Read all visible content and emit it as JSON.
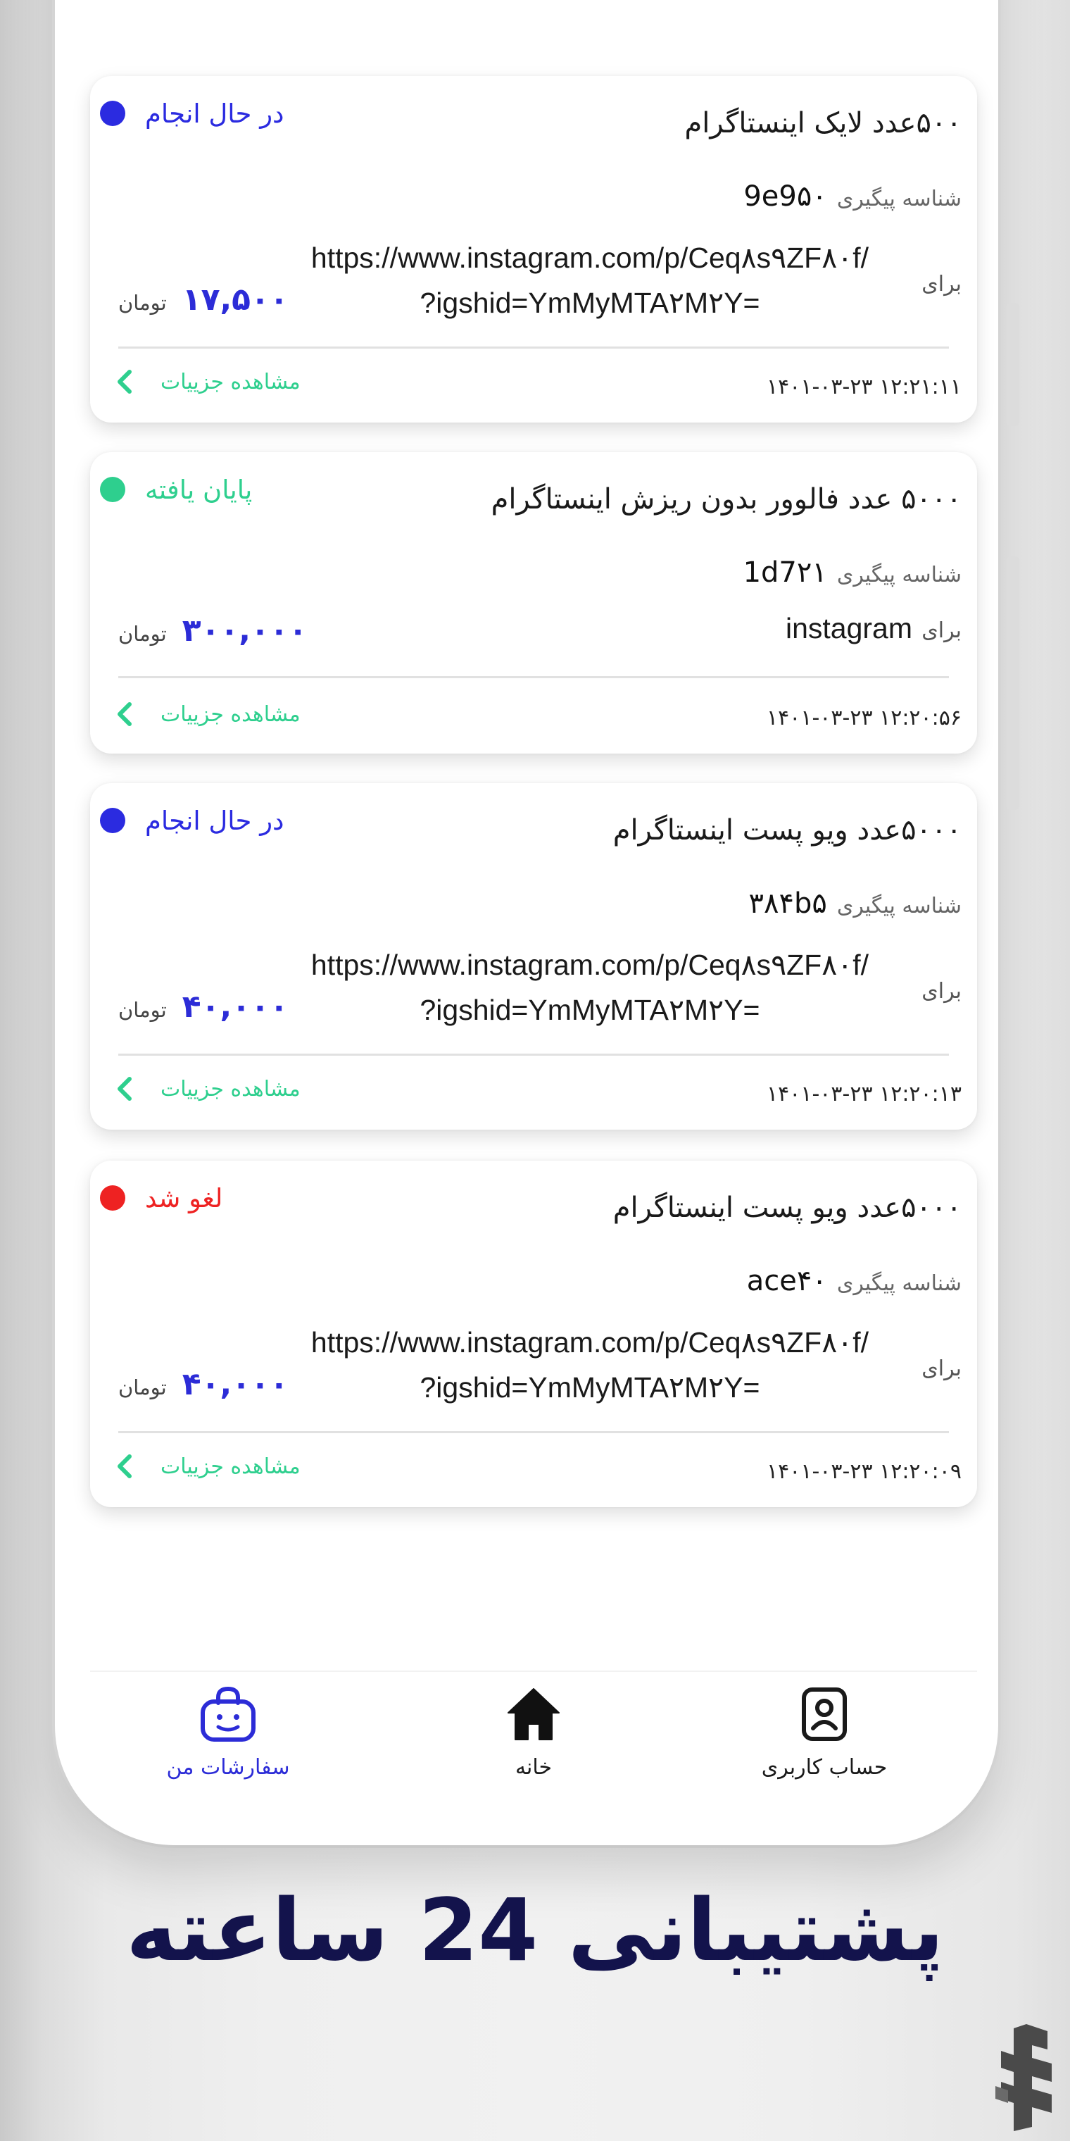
{
  "orders": [
    {
      "title": "۵۰۰عدد لایک اینستاگرام",
      "status": "در حال انجام",
      "status_color": "#2b2be0",
      "tracking_label": "شناسه پیگیری",
      "tracking_id": "9e9۵۰",
      "for_label": "برای",
      "target_line1": "https://www.instagram.com/p/Ceq۸s۹ZF۸۰f/",
      "target_line2": "?igshid=YmMyMTA۲M۲Y=",
      "price": "۱۷,۵۰۰",
      "currency": "تومان",
      "details_label": "مشاهده جزییات",
      "datetime": "۱۴۰۱-۰۳-۲۳ ۱۲:۲۱:۱۱"
    },
    {
      "title": "۵۰۰۰ عدد فالوور بدون ریزش اینستاگرام",
      "status": "پایان یافته",
      "status_color": "#2ecf8e",
      "tracking_label": "شناسه پیگیری",
      "tracking_id": "1d7۲۱",
      "for_label": "برای",
      "target_line1": "instagram",
      "price": "۳۰۰,۰۰۰",
      "currency": "تومان",
      "details_label": "مشاهده جزییات",
      "datetime": "۱۴۰۱-۰۳-۲۳ ۱۲:۲۰:۵۶"
    },
    {
      "title": "۵۰۰۰عدد ویو پست اینستاگرام",
      "status": "در حال انجام",
      "status_color": "#2b2be0",
      "tracking_label": "شناسه پیگیری",
      "tracking_id": "۳۸۴b۵",
      "for_label": "برای",
      "target_line1": "https://www.instagram.com/p/Ceq۸s۹ZF۸۰f/",
      "target_line2": "?igshid=YmMyMTA۲M۲Y=",
      "price": "۴۰,۰۰۰",
      "currency": "تومان",
      "details_label": "مشاهده جزییات",
      "datetime": "۱۴۰۱-۰۳-۲۳ ۱۲:۲۰:۱۳"
    },
    {
      "title": "۵۰۰۰عدد ویو پست اینستاگرام",
      "status": "لغو شد",
      "status_color": "#ee2222",
      "tracking_label": "شناسه پیگیری",
      "tracking_id": "ace۴۰",
      "for_label": "برای",
      "target_line1": "https://www.instagram.com/p/Ceq۸s۹ZF۸۰f/",
      "target_line2": "?igshid=YmMyMTA۲M۲Y=",
      "price": "۴۰,۰۰۰",
      "currency": "تومان",
      "details_label": "مشاهده جزییات",
      "datetime": "۱۴۰۱-۰۳-۲۳ ۱۲:۲۰:۰۹"
    }
  ],
  "bottom_nav": {
    "account": {
      "label": "حساب کاربری",
      "icon": "user-badge-icon"
    },
    "home": {
      "label": "خانه",
      "icon": "home-icon"
    },
    "orders": {
      "label": "سفارشات من",
      "icon": "shopping-basket-icon"
    }
  },
  "colors": {
    "accent": "#2c2cd7",
    "success": "#2ecf8e",
    "danger": "#ee2222",
    "banner_text": "#13134c"
  },
  "banner": "پشتیبانی 24 ساعته",
  "store_logo": {
    "icon": "store-logo-icon"
  }
}
